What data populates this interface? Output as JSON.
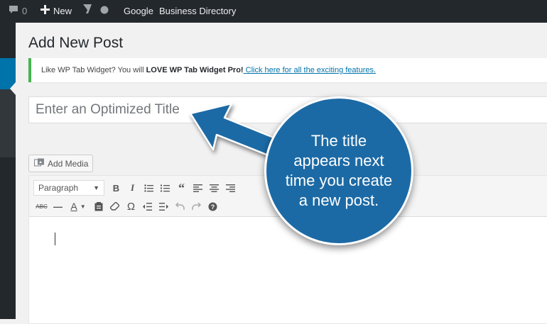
{
  "adminbar": {
    "comments_count": "0",
    "new_label": "New",
    "google_label": "Google",
    "directory_label": "Business Directory"
  },
  "page": {
    "title": "Add New Post"
  },
  "notice": {
    "text_plain": "Like WP Tab Widget? You will ",
    "text_bold": "LOVE WP Tab Widget Pro!",
    "link_text": " Click here for all the exciting features."
  },
  "editor": {
    "title_placeholder": "Enter an Optimized Title",
    "add_media_label": "Add Media",
    "format_select": "Paragraph",
    "toolbar_row1": [
      "B",
      "I",
      "☰",
      "≡",
      "❝",
      "≡",
      "≡",
      "≡"
    ],
    "toolbar_row2": [
      "ABC",
      "—",
      "A",
      "▤",
      "◇",
      "Ω",
      "⇤",
      "⇥",
      "↶",
      "↷",
      "?"
    ]
  },
  "callout": {
    "text": "The title appears next time you create a new post."
  },
  "colors": {
    "accent": "#0073aa",
    "callout": "#1c6aa5",
    "notice_border": "#46b450"
  }
}
